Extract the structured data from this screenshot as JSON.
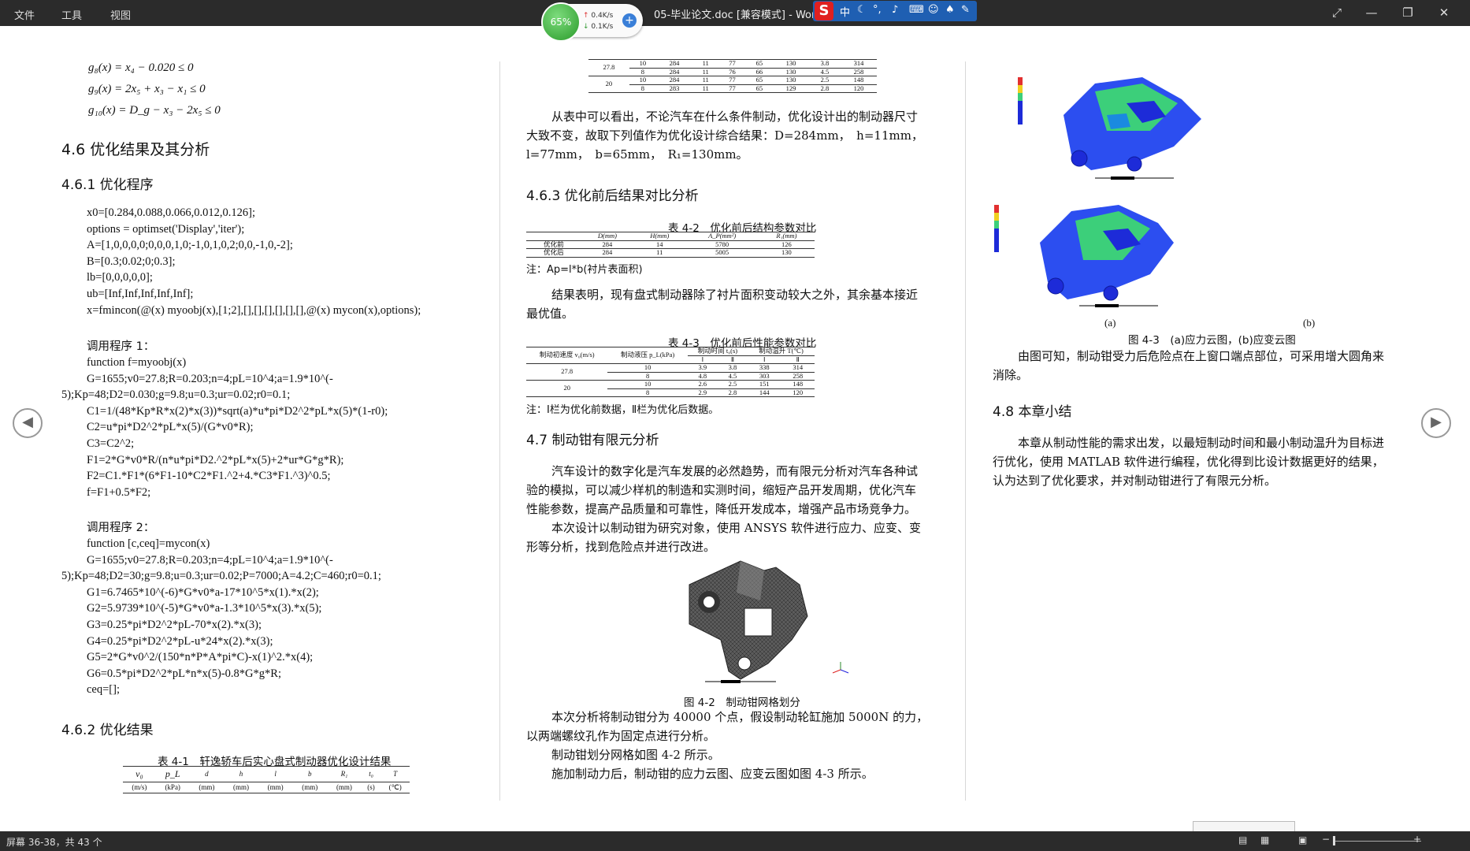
{
  "titlebar": {
    "menu": [
      "文件",
      "工具",
      "视图"
    ],
    "title": "05-毕业论文.doc [兼容模式] - Word",
    "net": {
      "percent": "65%",
      "up": "0.4K/s",
      "down": "0.1K/s"
    },
    "ime": {
      "lang": "中"
    }
  },
  "left": {
    "formulas": [
      "g₈(x) = x₄ − 0.020 ≤ 0",
      "g₉(x) = 2x₅ + x₃ − x₁ ≤ 0",
      "g₁₀(x) = D_g − x₃ − 2x₅ ≤ 0"
    ],
    "h46": "4.6 优化结果及其分析",
    "h461": "4.6.1 优化程序",
    "code1": [
      "x0=[0.284,0.088,0.066,0.012,0.126];",
      "options = optimset('Display','iter');",
      "A=[1,0,0,0,0;0,0,0,1,0;-1,0,1,0,2;0,0,-1,0,-2];",
      "B=[0.3;0.02;0;0.3];",
      "lb=[0,0,0,0,0];",
      "ub=[Inf,Inf,Inf,Inf,Inf];",
      "x=fmincon(@(x) myoobj(x),[1;2],[],[],[],[],[],[],@(x) mycon(x),options);"
    ],
    "sub1": "调用程序 1：",
    "code2": [
      "function f=myoobj(x)",
      "G=1655;v0=27.8;R=0.203;n=4;pL=10^4;a=1.9*10^(-",
      "5);Kp=48;D2=0.030;g=9.8;u=0.3;ur=0.02;r0=0.1;",
      "C1=1/(48*Kp*R*x(2)*x(3))*sqrt(a)*u*pi*D2^2*pL*x(5)*(1-r0);",
      "C2=u*pi*D2^2*pL*x(5)/(G*v0*R);",
      "C3=C2^2;",
      "F1=2*G*v0*R/(n*u*pi*D2.^2*pL*x(5)+2*ur*G*g*R);",
      "F2=C1.*F1*(6*F1-10*C2*F1.^2+4.*C3*F1.^3)^0.5;",
      "f=F1+0.5*F2;"
    ],
    "sub2": "调用程序 2：",
    "code3": [
      "function [c,ceq]=mycon(x)",
      "G=1655;v0=27.8;R=0.203;n=4;pL=10^4;a=1.9*10^(-",
      "5);Kp=48;D2=30;g=9.8;u=0.3;ur=0.02;P=7000;A=4.2;C=460;r0=0.1;",
      "G1=6.7465*10^(-6)*G*v0*a-17*10^5*x(1).*x(2);",
      "G2=5.9739*10^(-5)*G*v0*a-1.3*10^5*x(3).*x(5);",
      "G3=0.25*pi*D2^2*pL-70*x(2).*x(3);",
      "G4=0.25*pi*D2^2*pL-u*24*x(2).*x(3);",
      "G5=2*G*v0^2/(150*n*P*A*pi*C)-x(1)^2.*x(4);",
      "G6=0.5*pi*D2^2*pL*n*x(5)-0.8*G*g*R;",
      "ceq=[];"
    ],
    "h462": "4.6.2 优化结果",
    "t41cap": "表 4-1　轩逸轿车后实心盘式制动器优化设计结果",
    "t41head": [
      "v₀",
      "p_L",
      "d",
      "h",
      "l",
      "b",
      "R₁",
      "t₀",
      "T"
    ],
    "t41units": [
      "(m/s)",
      "(kPa)",
      "(mm)",
      "(mm)",
      "(mm)",
      "(mm)",
      "(mm)",
      "(s)",
      "(℃)"
    ]
  },
  "mid": {
    "toprows": [
      [
        "27.8",
        "10",
        "284",
        "11",
        "77",
        "65",
        "130",
        "3.8",
        "314"
      ],
      [
        "",
        "8",
        "284",
        "11",
        "76",
        "66",
        "130",
        "4.5",
        "258"
      ],
      [
        "20",
        "10",
        "284",
        "11",
        "77",
        "65",
        "130",
        "2.5",
        "148"
      ],
      [
        "",
        "8",
        "283",
        "11",
        "77",
        "65",
        "129",
        "2.8",
        "120"
      ]
    ],
    "p1a": "从表中可以看出，不论汽车在什么条件制动，优化设计出的制动器尺寸",
    "p1b": "大致不变，故取下列值作为优化设计综合结果：D=284mm，　h=11mm，",
    "p1c": "l=77mm，　b=65mm，　R₁=130mm。",
    "h463": "4.6.3 优化前后结果对比分析",
    "t42cap": "表 4-2　优化前后结构参数对比",
    "t42head": [
      "",
      "D(mm)",
      "H(mm)",
      "A_P(mm²)",
      "R₁(mm)"
    ],
    "t42rows": [
      [
        "优化前",
        "284",
        "14",
        "5780",
        "126"
      ],
      [
        "优化后",
        "284",
        "11",
        "5005",
        "130"
      ]
    ],
    "t42note": "注：Ap=l*b(衬片表面积)",
    "p2a": "结果表明，现有盘式制动器除了衬片面积变动较大之外，其余基本接近",
    "p2b": "最优值。",
    "t43cap": "表 4-3　优化前后性能参数对比",
    "t43head": [
      "制动初速度 v₀(m/s)",
      "制动液压 p_L(kPa)",
      "制动时间 t₀(s)",
      "制动温升 T(℃)"
    ],
    "t43sub": [
      "Ⅰ",
      "Ⅱ",
      "Ⅰ",
      "Ⅱ"
    ],
    "t43rows": [
      [
        "27.8",
        "10",
        "3.9",
        "3.8",
        "338",
        "314"
      ],
      [
        "",
        "8",
        "4.8",
        "4.5",
        "303",
        "258"
      ],
      [
        "20",
        "10",
        "2.6",
        "2.5",
        "151",
        "148"
      ],
      [
        "",
        "8",
        "2.9",
        "2.8",
        "144",
        "120"
      ]
    ],
    "t43note": "注：Ⅰ栏为优化前数据，Ⅱ栏为优化后数据。",
    "h47": "4.7 制动钳有限元分析",
    "p3": [
      "汽车设计的数字化是汽车发展的必然趋势，而有限元分析对汽车各种试",
      "验的模拟，可以减少样机的制造和实测时间，缩短产品开发周期，优化汽车",
      "性能参数，提高产品质量和可靠性，降低开发成本，增强产品市场竞争力。",
      "本次设计以制动钳为研究对象，使用 ANSYS 软件进行应力、应变、变",
      "形等分析，找到危险点并进行改进。"
    ],
    "fig42cap": "图 4-2　制动钳网格划分",
    "p4": [
      "本次分析将制动钳分为 40000 个点，假设制动轮缸施加 5000N 的力，",
      "以两端螺纹孔作为固定点进行分析。",
      "制动钳划分网格如图 4-2 所示。",
      "施加制动力后，制动钳的应力云图、应变云图如图 4-3 所示。"
    ]
  },
  "right": {
    "labelA": "(a)",
    "labelB": "(b)",
    "fig43cap": "图 4-3　(a)应力云图，(b)应变云图",
    "p5a": "由图可知，制动钳受力后危险点在上窗口端点部位，可采用增大圆角来",
    "p5b": "消除。",
    "h48": "4.8 本章小结",
    "p6": [
      "本章从制动性能的需求出发，以最短制动时间和最小制动温升为目标进",
      "行优化，使用 MATLAB 软件进行编程，优化得到比设计数据更好的结果，",
      "认为达到了优化要求，并对制动钳进行了有限元分析。"
    ]
  },
  "status": {
    "pages": "屏幕 36-38，共 43 个"
  },
  "colors": {
    "chrome": "#2b2b2b",
    "fem_blue": "#1d2bd8",
    "fem_green": "#3ccf7a"
  }
}
